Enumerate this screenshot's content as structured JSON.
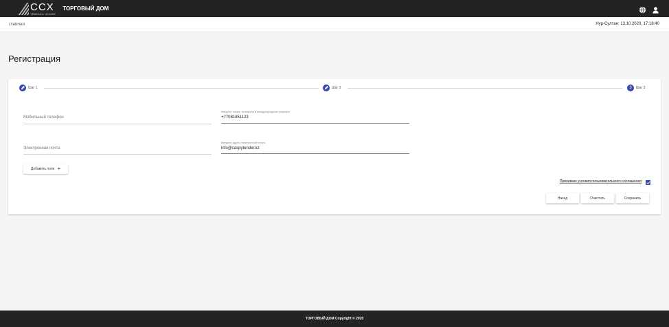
{
  "header": {
    "logo_text": "CCX",
    "logo_subtext": "TRADING HOUSE",
    "app_title": "ТОРГОВЫЙ ДОМ",
    "icons": [
      "globe-icon",
      "user-icon"
    ]
  },
  "breadcrumb": {
    "home": "ГЛАВНАЯ",
    "datetime": "Нур-Султан: 13.10.2020, 17:18:40"
  },
  "page": {
    "title": "Регистрация"
  },
  "stepper": {
    "steps": [
      {
        "label": "Шаг 1",
        "icon": "pencil-icon",
        "marker": ""
      },
      {
        "label": "Шаг 2",
        "icon": "pencil-icon",
        "marker": ""
      },
      {
        "label": "Шаг 3",
        "icon": "",
        "marker": "3"
      }
    ]
  },
  "form": {
    "phone": {
      "label": "Мобильный телефон",
      "hint": "Введите номер телефона в международном формате",
      "value": "+77081851123"
    },
    "email": {
      "label": "Электронная почта",
      "hint": "Введите адрес электронной почты",
      "value": "info@caspytender.kz"
    },
    "add_field_label": "Добавить поле"
  },
  "agreement": {
    "text": "Принимаю условия пользовательского соглашения",
    "checked": true
  },
  "actions": {
    "back": "Назад",
    "clear": "Очистить",
    "save": "Сохранить"
  },
  "footer": {
    "text": "ТОРГОВЫЙ ДОМ Copyright © 2020"
  },
  "colors": {
    "topbar": "#232323",
    "accent": "#3949ab",
    "background": "#f5f5f5"
  }
}
